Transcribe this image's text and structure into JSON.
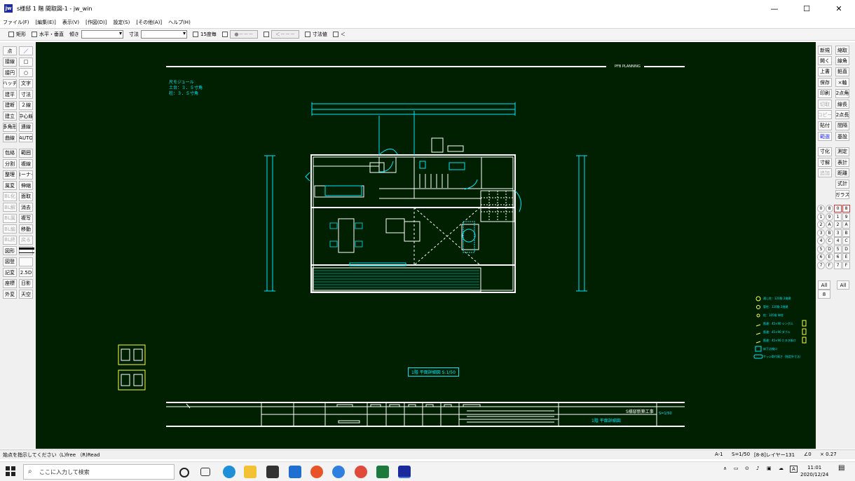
{
  "window": {
    "app_icon": "jw",
    "title": "s様邸 1 階 間取図-1 - jw_win",
    "minimize_label": "—",
    "maximize_label": "☐",
    "close_label": "✕"
  },
  "menu": [
    "ファイル(F)",
    "[編集(E)]",
    "表示(V)",
    "[作図(D)]",
    "設定(S)",
    "[その他(A)]",
    "ヘルプ(H)"
  ],
  "options": {
    "rect": "矩形",
    "horiz_vert": "水平・垂直",
    "tilt": "傾き",
    "dim": "寸法",
    "deg15": "15度毎",
    "ball_btn": "●－－－",
    "arrow_btn": "＜－－－",
    "dim_value": "寸法値",
    "lt": "＜"
  },
  "left_tools": [
    [
      "点",
      "／"
    ],
    [
      "接線",
      "□"
    ],
    [
      "接円",
      "○"
    ],
    [
      "ハッチ",
      "文字"
    ],
    [
      "建平",
      "寸法"
    ],
    [
      "建断",
      "２線"
    ],
    [
      "建立",
      "中心線"
    ],
    [
      "多角形",
      "連線"
    ],
    [
      "曲線",
      "AUTO"
    ],
    [
      "包絡",
      "範囲"
    ],
    [
      "分割",
      "複線"
    ],
    [
      "整理",
      "コーナー"
    ],
    [
      "属変",
      "伸縮"
    ],
    [
      "BL化",
      "面取"
    ],
    [
      "BL解",
      "消去"
    ],
    [
      "BL属",
      "複写"
    ],
    [
      "BL編",
      "移動"
    ],
    [
      "BL終",
      "戻る"
    ],
    [
      "図形",
      ""
    ],
    [
      "図登",
      ""
    ],
    [
      "記変",
      "2.5D"
    ],
    [
      "座標",
      "日影"
    ],
    [
      "外変",
      "天空"
    ]
  ],
  "right_tools": [
    [
      "新規",
      "縮取"
    ],
    [
      "開く",
      "線角"
    ],
    [
      "上書",
      "鉛直"
    ],
    [
      "保存",
      "×軸"
    ],
    [
      "印刷",
      "2点角"
    ],
    [
      "切取",
      "線長"
    ],
    [
      "コピー",
      "2点長"
    ],
    [
      "貼付",
      "間隔"
    ],
    [
      "範選",
      "基設"
    ],
    [
      "寸化",
      "測定"
    ],
    [
      "寸解",
      "表計"
    ],
    [
      "追加",
      "距離"
    ],
    [
      "",
      "式計"
    ],
    [
      "",
      "ガラス"
    ]
  ],
  "layer_buttons": {
    "left": [
      "0",
      "1",
      "2",
      "3",
      "4",
      "5",
      "6",
      "7"
    ],
    "right": [
      "8",
      "9",
      "A",
      "B",
      "C",
      "D",
      "E",
      "F"
    ],
    "mid_left": [
      "8",
      "9",
      "A",
      "B",
      "C",
      "D",
      "E",
      "F"
    ],
    "mid_right": [
      "0",
      "1",
      "2",
      "3",
      "4",
      "5",
      "6",
      "7"
    ],
    "all": "All",
    "num8": "8"
  },
  "drawing": {
    "header_label": "PFB PLANNING",
    "note_line1": "尺モジュール",
    "note_line2": "土台：３．５寸角",
    "note_line3": "柱：３．５寸角",
    "plan_title": "1階 平面詳細図 S:1/50",
    "titleblock_project": "S様邸新築工事",
    "titleblock_drawing": "1階 平面詳細図",
    "titleblock_scale": "S=1/50",
    "legend": [
      "通し柱：120角 2階建",
      "管柱：120角 2階建",
      "柱：105角 単柱",
      "筋違：45×90 シングル",
      "筋違：45×90 ダブル",
      "筋違：45×90 たすき掛け",
      "床下点検口",
      "サッシ取付高さ（指定外寸法）"
    ]
  },
  "status": {
    "prompt": "始点を指示してください（L)free （R)Read",
    "paper": "A-1",
    "scale": "S=1/50",
    "layer": "[8-8]レイヤー131",
    "angle": "∠0",
    "zoom": "× 0.27"
  },
  "taskbar": {
    "search_placeholder": "ここに入力して検索",
    "time": "11:01",
    "date": "2020/12/24",
    "ime": "A"
  },
  "colors": {
    "canvas_bg": "#012001",
    "cyan": "#00e5ff",
    "white": "#ffffff",
    "yellow": "#ffff40"
  }
}
